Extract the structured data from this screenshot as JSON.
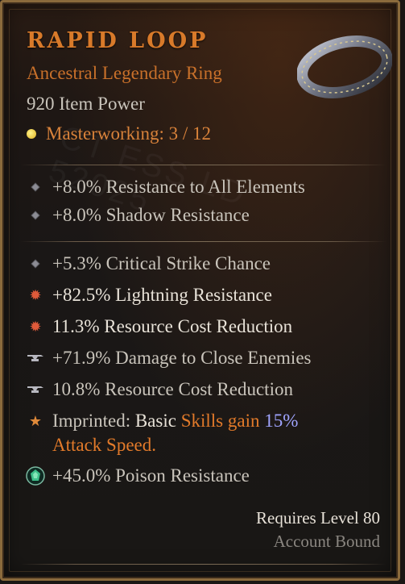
{
  "item": {
    "name": "RAPID LOOP",
    "type": "Ancestral Legendary Ring",
    "item_power": "920 Item Power",
    "masterworking": "Masterworking: 3 / 12"
  },
  "watermark": "CT ESS LD\n52025",
  "implicit_stats": [
    {
      "text": "+8.0% Resistance to All Elements",
      "icon": "diamond-bullet"
    },
    {
      "text": "+8.0% Shadow Resistance",
      "icon": "diamond-bullet"
    }
  ],
  "affixes": [
    {
      "text": "+5.3% Critical Strike Chance",
      "icon": "diamond-bullet"
    },
    {
      "text": "+82.5% Lightning Resistance",
      "icon": "greater-affix-burst-icon"
    },
    {
      "text": "11.3% Resource Cost Reduction",
      "icon": "greater-affix-burst-icon"
    },
    {
      "text": "+71.9% Damage to Close Enemies",
      "icon": "tempered-anvil-icon"
    },
    {
      "text": "10.8% Resource Cost Reduction",
      "icon": "tempered-anvil-icon"
    }
  ],
  "imprint": {
    "prefix": "Imprinted:",
    "basic": "Basic",
    "skills_gain": "Skills gain",
    "percent": "15%",
    "line2": "Attack Speed.",
    "icon": "imprint-star-icon"
  },
  "socket": {
    "text": "+45.0% Poison Resistance",
    "icon": "poison-gem-icon"
  },
  "requirements": {
    "level": "Requires Level 80",
    "bound": "Account Bound"
  },
  "colors": {
    "title": "#d87a2a",
    "legendary": "#c8702a",
    "stat": "#c9c4bb",
    "highlight_percent": "#a0a4ff"
  }
}
